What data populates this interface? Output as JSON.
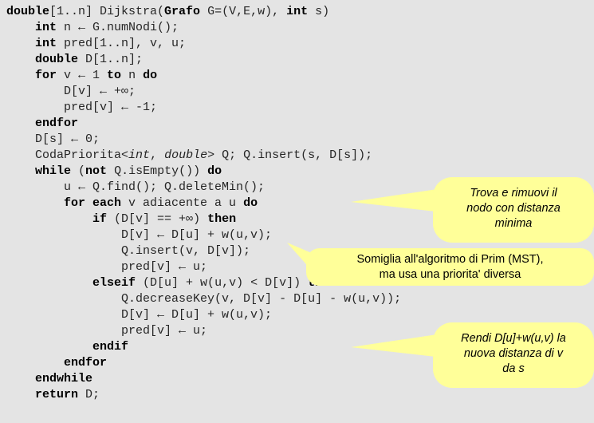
{
  "theme": {
    "background": "#e4e4e4",
    "code_color": "#262626",
    "callout_fill": "#ffff99",
    "callout_text": "#000000"
  },
  "code": {
    "language": "pseudocode",
    "title": "Dijkstra",
    "lines": [
      {
        "indent": 0,
        "tokens": [
          {
            "t": "double",
            "s": "kw"
          },
          {
            "t": "[1..n] Dijkstra(",
            "s": "plain"
          },
          {
            "t": "Grafo",
            "s": "kw"
          },
          {
            "t": " G=(V,E,w), ",
            "s": "plain"
          },
          {
            "t": "int",
            "s": "kw"
          },
          {
            "t": " s)",
            "s": "plain"
          }
        ]
      },
      {
        "indent": 1,
        "tokens": [
          {
            "t": "int",
            "s": "kw"
          },
          {
            "t": " n ← G.numNodi();",
            "s": "plain"
          }
        ]
      },
      {
        "indent": 1,
        "tokens": [
          {
            "t": "int",
            "s": "kw"
          },
          {
            "t": " pred[1..n], v, u;",
            "s": "plain"
          }
        ]
      },
      {
        "indent": 1,
        "tokens": [
          {
            "t": "double",
            "s": "kw"
          },
          {
            "t": " D[1..n];",
            "s": "plain"
          }
        ]
      },
      {
        "indent": 1,
        "tokens": [
          {
            "t": "for",
            "s": "kw"
          },
          {
            "t": " v ← 1 ",
            "s": "plain"
          },
          {
            "t": "to",
            "s": "kw"
          },
          {
            "t": " n ",
            "s": "plain"
          },
          {
            "t": "do",
            "s": "kw"
          }
        ]
      },
      {
        "indent": 2,
        "tokens": [
          {
            "t": "D[v] ← +∞;",
            "s": "plain"
          }
        ]
      },
      {
        "indent": 2,
        "tokens": [
          {
            "t": "pred[v] ← -1;",
            "s": "plain"
          }
        ]
      },
      {
        "indent": 1,
        "tokens": [
          {
            "t": "endfor",
            "s": "kw"
          }
        ]
      },
      {
        "indent": 1,
        "tokens": [
          {
            "t": "D[s] ← 0;",
            "s": "plain"
          }
        ]
      },
      {
        "indent": 1,
        "tokens": [
          {
            "t": "CodaPriorita<",
            "s": "plain"
          },
          {
            "t": "int",
            "s": "ital"
          },
          {
            "t": ", ",
            "s": "plain"
          },
          {
            "t": "double",
            "s": "ital"
          },
          {
            "t": "> Q; Q.insert(s, D[s]);",
            "s": "plain"
          }
        ]
      },
      {
        "indent": 1,
        "tokens": [
          {
            "t": "while",
            "s": "kw"
          },
          {
            "t": " (",
            "s": "plain"
          },
          {
            "t": "not",
            "s": "kw"
          },
          {
            "t": " Q.isEmpty()) ",
            "s": "plain"
          },
          {
            "t": "do",
            "s": "kw"
          }
        ]
      },
      {
        "indent": 2,
        "tokens": [
          {
            "t": "u ← Q.find(); Q.deleteMin();",
            "s": "plain"
          }
        ]
      },
      {
        "indent": 2,
        "tokens": [
          {
            "t": "for each",
            "s": "kw"
          },
          {
            "t": " v adiacente a u ",
            "s": "plain"
          },
          {
            "t": "do",
            "s": "kw"
          }
        ]
      },
      {
        "indent": 3,
        "tokens": [
          {
            "t": "if",
            "s": "kw"
          },
          {
            "t": " (D[v] == +∞) ",
            "s": "plain"
          },
          {
            "t": "then",
            "s": "kw"
          }
        ]
      },
      {
        "indent": 4,
        "tokens": [
          {
            "t": "D[v] ← D[u] + w(u,v);",
            "s": "plain"
          }
        ]
      },
      {
        "indent": 4,
        "tokens": [
          {
            "t": "Q.insert(v, D[v]);",
            "s": "plain"
          }
        ]
      },
      {
        "indent": 4,
        "tokens": [
          {
            "t": "pred[v] ← u;",
            "s": "plain"
          }
        ]
      },
      {
        "indent": 3,
        "tokens": [
          {
            "t": "elseif",
            "s": "kw"
          },
          {
            "t": " (D[u] + w(u,v) < D[v]) ",
            "s": "plain"
          },
          {
            "t": "then",
            "s": "kw"
          }
        ]
      },
      {
        "indent": 4,
        "tokens": [
          {
            "t": "Q.decreaseKey(v, D[v] - D[u] - w(u,v));",
            "s": "plain"
          }
        ]
      },
      {
        "indent": 4,
        "tokens": [
          {
            "t": "D[v] ← D[u] + w(u,v);",
            "s": "plain"
          }
        ]
      },
      {
        "indent": 4,
        "tokens": [
          {
            "t": "pred[v] ← u;",
            "s": "plain"
          }
        ]
      },
      {
        "indent": 3,
        "tokens": [
          {
            "t": "endif",
            "s": "kw"
          }
        ]
      },
      {
        "indent": 2,
        "tokens": [
          {
            "t": "endfor",
            "s": "kw"
          }
        ]
      },
      {
        "indent": 1,
        "tokens": [
          {
            "t": "endwhile",
            "s": "kw"
          }
        ]
      },
      {
        "indent": 1,
        "tokens": [
          {
            "t": "return",
            "s": "kw"
          },
          {
            "t": " D;",
            "s": "plain"
          }
        ]
      }
    ]
  },
  "callouts": {
    "find": {
      "lines": [
        "Trova e rimuovi il",
        "nodo con distanza",
        "minima"
      ],
      "style": "italic",
      "points_to": "u ← Q.find(); Q.deleteMin();"
    },
    "prim": {
      "lines": [
        "Somiglia all'algoritmo di Prim (MST),",
        "ma usa una priorita' diversa"
      ],
      "style": "regular",
      "points_to": "Q.insert(v, D[v]);"
    },
    "rendi": {
      "lines": [
        "Rendi D[u]+w(u,v) la",
        "nuova distanza di v",
        "da s"
      ],
      "style": "italic",
      "points_to": "D[v] ← D[u] + w(u,v);"
    }
  }
}
